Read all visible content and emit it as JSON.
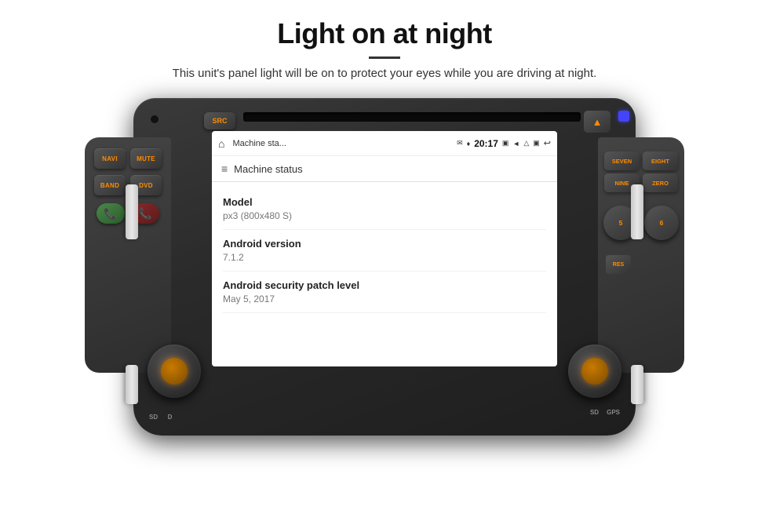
{
  "page": {
    "title": "Light on at night",
    "divider": true,
    "subtitle": "This unit's panel light will be on to protect your eyes while you are driving at night."
  },
  "unit": {
    "src_label": "SRC",
    "cd_slot": "CD",
    "warning_icon": "▲",
    "left_buttons": [
      {
        "label": "NAVI"
      },
      {
        "label": "MUTE"
      },
      {
        "label": "BAND"
      },
      {
        "label": "DVD"
      }
    ],
    "phone_green": "☎",
    "phone_red": "☎",
    "right_buttons": [
      {
        "label": "SEVEN"
      },
      {
        "label": "EIGHT"
      },
      {
        "label": "NINE"
      },
      {
        "label": "ZERO"
      }
    ],
    "right_large_btn": "5",
    "right_large_btn2": "6",
    "right_extra": "RES",
    "bottom_left_label": "SD",
    "bottom_left_label2": "D",
    "bottom_right_label": "SD",
    "bottom_right_label2": "GPS"
  },
  "screen": {
    "statusbar": {
      "home_icon": "⌂",
      "title": "Machine sta...",
      "icons": "✉ ❖ ♦ 20:17 ▣ ◄ △ ▣ ↩ ↪",
      "time": "20:17"
    },
    "topbar": {
      "menu_icon": "≡",
      "label": "Machine status"
    },
    "items": [
      {
        "label": "Model",
        "value": "px3 (800x480 S)"
      },
      {
        "label": "Android version",
        "value": "7.1.2"
      },
      {
        "label": "Android security patch level",
        "value": "May 5, 2017"
      }
    ]
  }
}
